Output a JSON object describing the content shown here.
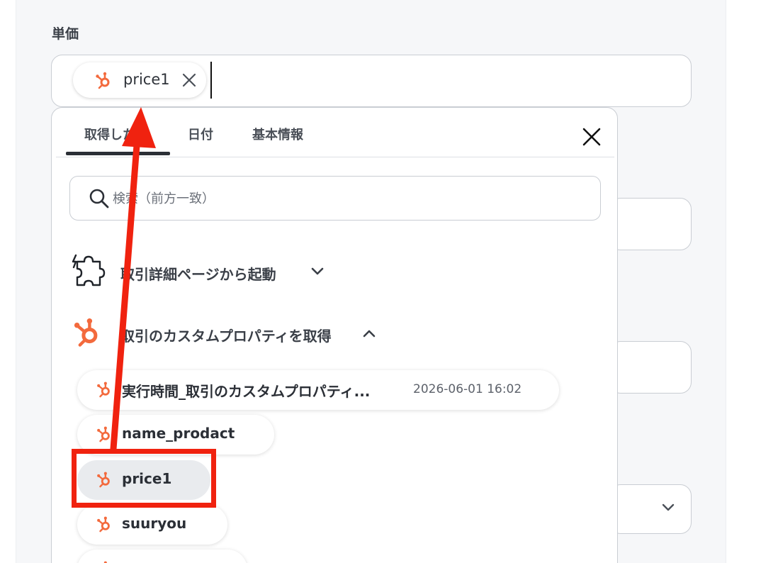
{
  "field": {
    "label": "単価"
  },
  "input": {
    "chip_label": "price1",
    "chip_icon": "hubspot-icon"
  },
  "dropdown": {
    "tabs": [
      {
        "label": "取得した値",
        "active": true
      },
      {
        "label": "日付",
        "active": false
      },
      {
        "label": "基本情報",
        "active": false
      }
    ],
    "close_icon": "close-icon",
    "search": {
      "placeholder": "検索（前方一致）",
      "value": "",
      "icon": "search-icon"
    },
    "groups": [
      {
        "label": "取引詳細ページから起動",
        "icon": "puzzle-bolt-icon",
        "expanded": false
      },
      {
        "label": "取引のカスタムプロパティを取得",
        "icon": "hubspot-icon",
        "expanded": true
      }
    ],
    "items": [
      {
        "label": "実行時間_取引のカスタムプロパティ...",
        "value": "2026-06-01 16:02"
      },
      {
        "label": "name_prodact",
        "value": ""
      },
      {
        "label": "price1",
        "value": "",
        "selected": true
      },
      {
        "label": "suuryou",
        "value": ""
      }
    ]
  },
  "annotation": {
    "color": "#f0220f"
  },
  "colors": {
    "hubspot": "#f36a3d",
    "accent_text": "#2b2f36"
  }
}
